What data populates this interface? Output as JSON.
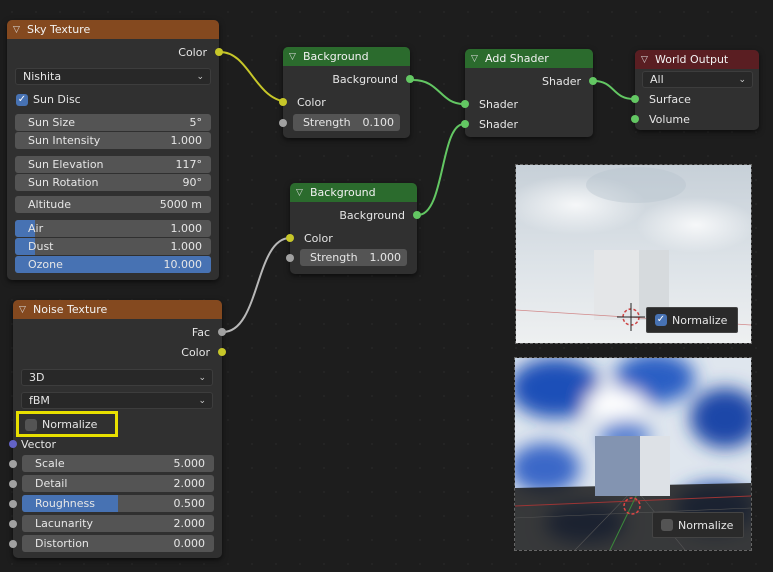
{
  "colors": {
    "texture_header": "#84491f",
    "shader_header": "#2b6b2d",
    "output_header": "#5a1e22",
    "color_socket": "#c7c729",
    "shader_socket": "#63c763",
    "float_socket": "#a1a1a1",
    "vector_socket": "#6363c7",
    "accent": "#4772b3",
    "highlight": "#e8e000"
  },
  "sky": {
    "title": "Sky Texture",
    "out_color": "Color",
    "type": "Nishita",
    "sun_disc": "Sun Disc",
    "fields": [
      {
        "label": "Sun Size",
        "value": "5°"
      },
      {
        "label": "Sun Intensity",
        "value": "1.000"
      },
      {
        "label": "Sun Elevation",
        "value": "117°"
      },
      {
        "label": "Sun Rotation",
        "value": "90°"
      },
      {
        "label": "Altitude",
        "value": "5000 m"
      },
      {
        "label": "Air",
        "value": "1.000",
        "fill": 0.1
      },
      {
        "label": "Dust",
        "value": "1.000",
        "fill": 0.1
      },
      {
        "label": "Ozone",
        "value": "10.000",
        "fill": 1.0
      }
    ]
  },
  "bg1": {
    "title": "Background",
    "out": "Background",
    "in_color": "Color",
    "strength_label": "Strength",
    "strength": "0.100"
  },
  "bg2": {
    "title": "Background",
    "out": "Background",
    "in_color": "Color",
    "strength_label": "Strength",
    "strength": "1.000"
  },
  "add": {
    "title": "Add Shader",
    "out": "Shader",
    "in1": "Shader",
    "in2": "Shader"
  },
  "world": {
    "title": "World Output",
    "target": "All",
    "surface": "Surface",
    "volume": "Volume"
  },
  "noise": {
    "title": "Noise Texture",
    "out_fac": "Fac",
    "out_color": "Color",
    "dimensions": "3D",
    "type": "fBM",
    "normalize": "Normalize",
    "vector": "Vector",
    "fields": [
      {
        "label": "Scale",
        "value": "5.000",
        "fill": 0
      },
      {
        "label": "Detail",
        "value": "2.000",
        "fill": 0
      },
      {
        "label": "Roughness",
        "value": "0.500",
        "fill": 0.5
      },
      {
        "label": "Lacunarity",
        "value": "2.000",
        "fill": 0
      },
      {
        "label": "Distortion",
        "value": "0.000",
        "fill": 0
      }
    ]
  },
  "preview_top": {
    "normalize": "Normalize",
    "checked": true
  },
  "preview_bottom": {
    "normalize": "Normalize",
    "checked": false
  }
}
